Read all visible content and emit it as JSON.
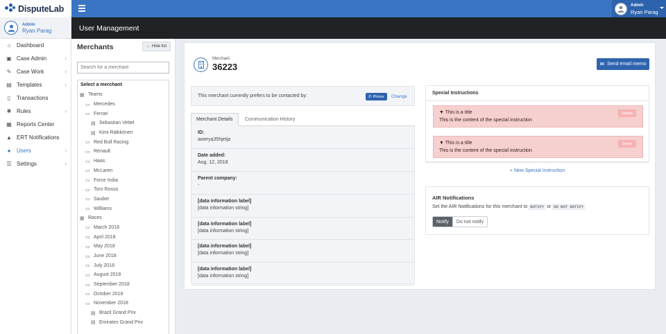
{
  "brand": {
    "name": "DisputeLab"
  },
  "top_user": {
    "role": "Admin",
    "name": "Ryan Parag"
  },
  "side_user": {
    "role": "Admin",
    "name": "Ryan Parag"
  },
  "nav": [
    {
      "label": "Dashboard",
      "icon": "home-icon",
      "glyph": "⌂",
      "chevron": false,
      "active": false
    },
    {
      "label": "Case Admin",
      "icon": "briefcase-icon",
      "glyph": "▣",
      "chevron": true,
      "active": false
    },
    {
      "label": "Case Work",
      "icon": "edit-icon",
      "glyph": "✎",
      "chevron": true,
      "active": false
    },
    {
      "label": "Templates",
      "icon": "file-icon",
      "glyph": "▤",
      "chevron": true,
      "active": false
    },
    {
      "label": "Transactions",
      "icon": "document-icon",
      "glyph": "▯",
      "chevron": false,
      "active": false
    },
    {
      "label": "Rules",
      "icon": "gear-icon",
      "glyph": "✱",
      "chevron": true,
      "active": false
    },
    {
      "label": "Reports Center",
      "icon": "report-icon",
      "glyph": "▦",
      "chevron": false,
      "active": false
    },
    {
      "label": "ERT Notifications",
      "icon": "warning-icon",
      "glyph": "▲",
      "chevron": false,
      "active": false
    },
    {
      "label": "Users",
      "icon": "users-icon",
      "glyph": "●",
      "chevron": true,
      "active": true
    },
    {
      "label": "Settings",
      "icon": "sliders-icon",
      "glyph": "☰",
      "chevron": true,
      "active": false
    }
  ],
  "header": {
    "title": "User Management"
  },
  "merchants_panel": {
    "title": "Merchants",
    "hide_label": "Hide list",
    "search_placeholder": "Search for a merchant",
    "tree_header": "Select a merchant",
    "tree": [
      {
        "label": "Teams",
        "level": 0,
        "type": "group"
      },
      {
        "label": "Mercedes",
        "level": 1,
        "type": "folder"
      },
      {
        "label": "Ferrari",
        "level": 1,
        "type": "folder"
      },
      {
        "label": "Sebastian Vettel",
        "level": 2,
        "type": "item"
      },
      {
        "label": "Kimi Räikkönen",
        "level": 2,
        "type": "item"
      },
      {
        "label": "Red Bull Racing",
        "level": 1,
        "type": "folder"
      },
      {
        "label": "Renault",
        "level": 1,
        "type": "folder"
      },
      {
        "label": "Haas",
        "level": 1,
        "type": "folder"
      },
      {
        "label": "McLaren",
        "level": 1,
        "type": "folder"
      },
      {
        "label": "Force India",
        "level": 1,
        "type": "folder"
      },
      {
        "label": "Toro Rosso",
        "level": 1,
        "type": "folder"
      },
      {
        "label": "Sauber",
        "level": 1,
        "type": "folder"
      },
      {
        "label": "Williams",
        "level": 1,
        "type": "folder"
      },
      {
        "label": "Races",
        "level": 0,
        "type": "group"
      },
      {
        "label": "March 2018",
        "level": 1,
        "type": "folder"
      },
      {
        "label": "April 2018",
        "level": 1,
        "type": "folder"
      },
      {
        "label": "May 2018",
        "level": 1,
        "type": "folder"
      },
      {
        "label": "June 2018",
        "level": 1,
        "type": "folder"
      },
      {
        "label": "July 2018",
        "level": 1,
        "type": "folder"
      },
      {
        "label": "August 2018",
        "level": 1,
        "type": "folder"
      },
      {
        "label": "September 2018",
        "level": 1,
        "type": "folder"
      },
      {
        "label": "October 2018",
        "level": 1,
        "type": "folder"
      },
      {
        "label": "November 2018",
        "level": 1,
        "type": "folder"
      },
      {
        "label": "Brazil Grand Prix",
        "level": 2,
        "type": "item"
      },
      {
        "label": "Emirates Grand Prix",
        "level": 2,
        "type": "item"
      }
    ]
  },
  "merchant": {
    "label": "Merchant",
    "id": "36223",
    "email_button": "Send email memo",
    "contact_text": "This merchant currently prefers to be contacted by:",
    "contact_method": "Phone",
    "change_label": "Change"
  },
  "tabs": [
    {
      "label": "Merchant Details",
      "active": true
    },
    {
      "label": "Communication History",
      "active": false
    }
  ],
  "details": [
    {
      "label": "ID:",
      "value": "aweryq35hjetja"
    },
    {
      "label": "Date added:",
      "value": "Aug. 12, 2018"
    },
    {
      "label": "Parent company:",
      "value": "-"
    },
    {
      "label": "[data information label]",
      "value": "[data information string]"
    },
    {
      "label": "[data information label]",
      "value": "[data information string]"
    },
    {
      "label": "[data information label]",
      "value": "[data information string]"
    },
    {
      "label": "[data information label]",
      "value": "[data information string]"
    }
  ],
  "special_instructions": {
    "title": "Special Instructions",
    "items": [
      {
        "title": "▼ This is a title",
        "content": "This is the content of the special instruction",
        "action": "Update"
      },
      {
        "title": "▼ This is a title",
        "content": "This is the content of the special instruction",
        "action": "Delete"
      }
    ],
    "new_label": "+ New Special Instruction"
  },
  "air": {
    "title": "AIR Notifications",
    "desc_prefix": "Set the AIR Notifications for this merchant to",
    "code_notify": "NOTIFY",
    "desc_or": "or",
    "code_do_not": "DO NOT NOTIFY",
    "btn_notify": "Notify",
    "btn_do_not": "Do not notify"
  },
  "colors": {
    "primary": "#3a75c4",
    "header_dark": "#1f2326",
    "alert_bg": "#f6cfcf"
  }
}
